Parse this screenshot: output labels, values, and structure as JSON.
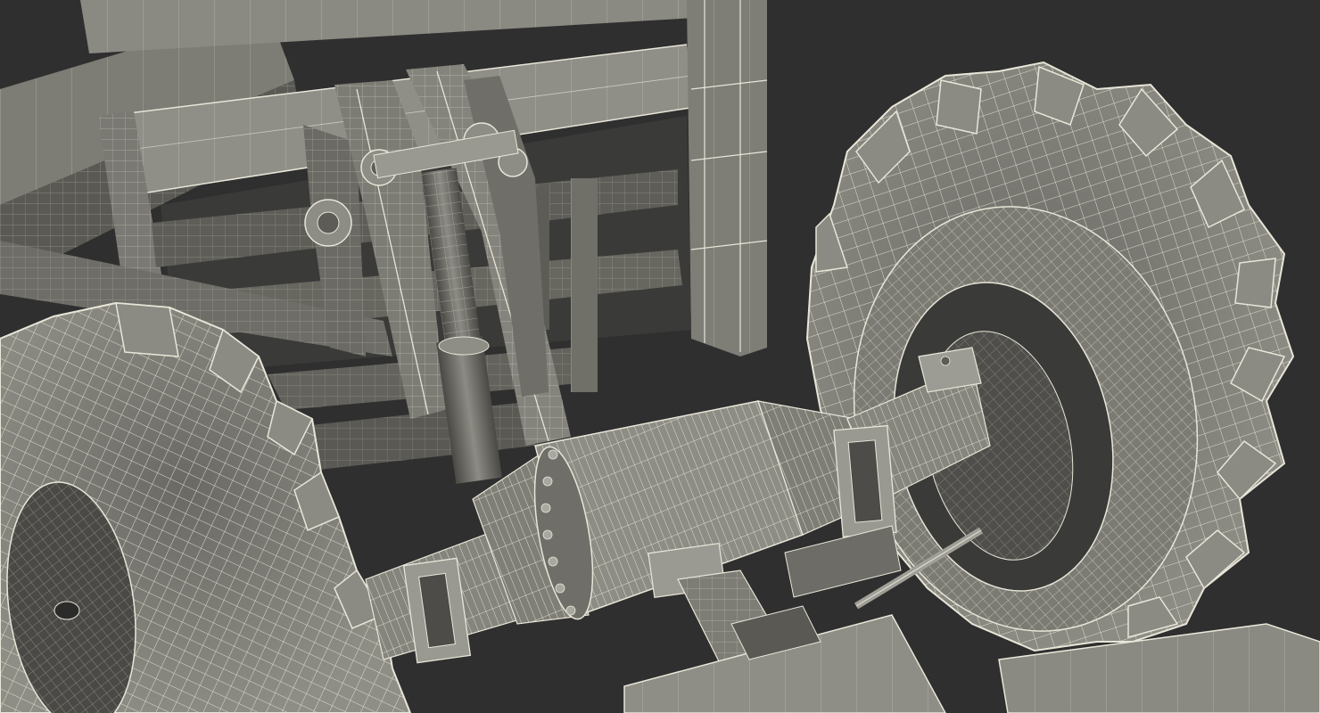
{
  "image": {
    "subject": "wireframe-3d-render",
    "colors": {
      "background": "#2f2f2f",
      "surface_light": "#8b8a83",
      "surface_mid": "#6f6e68",
      "surface_dark": "#4f4e4a",
      "shadow": "#262626",
      "wire": "#e8e6d8"
    }
  }
}
